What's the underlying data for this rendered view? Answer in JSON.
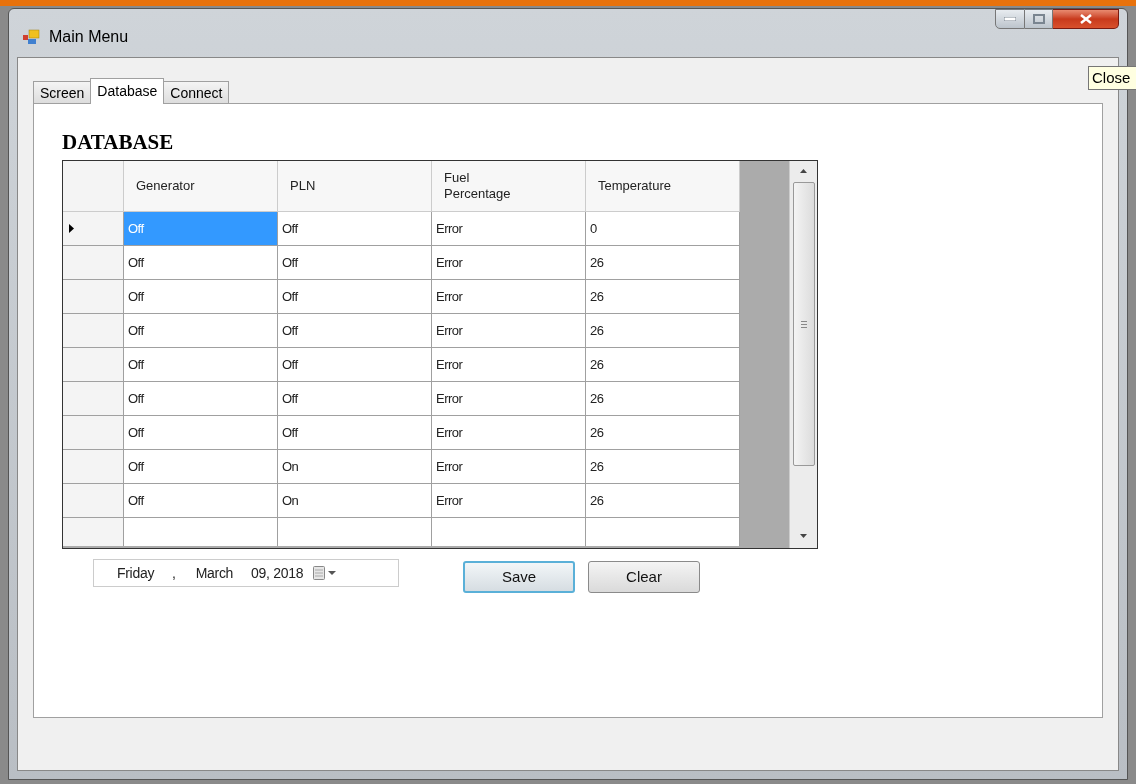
{
  "window": {
    "title": "Main Menu"
  },
  "tooltip": {
    "text": "Close"
  },
  "tabs": [
    {
      "label": "Screen",
      "selected": false
    },
    {
      "label": "Database",
      "selected": true
    },
    {
      "label": "Connect",
      "selected": false
    }
  ],
  "heading": "DATABASE",
  "table": {
    "columns": [
      "Generator",
      "PLN",
      "Fuel Percentage",
      "Temperature"
    ],
    "rows": [
      {
        "selected": true,
        "cells": [
          {
            "text": "Off",
            "selected": true
          },
          {
            "text": "Off",
            "selected": false
          },
          {
            "text": "Error",
            "selected": false
          },
          {
            "text": "0",
            "selected": false
          }
        ]
      },
      {
        "selected": false,
        "cells": [
          {
            "text": "Off",
            "selected": false
          },
          {
            "text": "Off",
            "selected": false
          },
          {
            "text": "Error",
            "selected": false
          },
          {
            "text": "26",
            "selected": false
          }
        ]
      },
      {
        "selected": false,
        "cells": [
          {
            "text": "Off",
            "selected": false
          },
          {
            "text": "Off",
            "selected": false
          },
          {
            "text": "Error",
            "selected": false
          },
          {
            "text": "26",
            "selected": false
          }
        ]
      },
      {
        "selected": false,
        "cells": [
          {
            "text": "Off",
            "selected": false
          },
          {
            "text": "Off",
            "selected": false
          },
          {
            "text": "Error",
            "selected": false
          },
          {
            "text": "26",
            "selected": false
          }
        ]
      },
      {
        "selected": false,
        "cells": [
          {
            "text": "Off",
            "selected": false
          },
          {
            "text": "Off",
            "selected": false
          },
          {
            "text": "Error",
            "selected": false
          },
          {
            "text": "26",
            "selected": false
          }
        ]
      },
      {
        "selected": false,
        "cells": [
          {
            "text": "Off",
            "selected": false
          },
          {
            "text": "Off",
            "selected": false
          },
          {
            "text": "Error",
            "selected": false
          },
          {
            "text": "26",
            "selected": false
          }
        ]
      },
      {
        "selected": false,
        "cells": [
          {
            "text": "Off",
            "selected": false
          },
          {
            "text": "Off",
            "selected": false
          },
          {
            "text": "Error",
            "selected": false
          },
          {
            "text": "26",
            "selected": false
          }
        ]
      },
      {
        "selected": false,
        "cells": [
          {
            "text": "Off",
            "selected": false
          },
          {
            "text": "On",
            "selected": false
          },
          {
            "text": "Error",
            "selected": false
          },
          {
            "text": "26",
            "selected": false
          }
        ]
      },
      {
        "selected": false,
        "cells": [
          {
            "text": "Off",
            "selected": false
          },
          {
            "text": "On",
            "selected": false
          },
          {
            "text": "Error",
            "selected": false
          },
          {
            "text": "26",
            "selected": false
          }
        ]
      }
    ]
  },
  "date_picker": {
    "weekday": "Friday",
    "separator": ",",
    "month": "March",
    "day_year": "09, 2018"
  },
  "buttons": [
    {
      "label": "Save",
      "kind": "default"
    },
    {
      "label": "Clear",
      "kind": "normal"
    }
  ]
}
